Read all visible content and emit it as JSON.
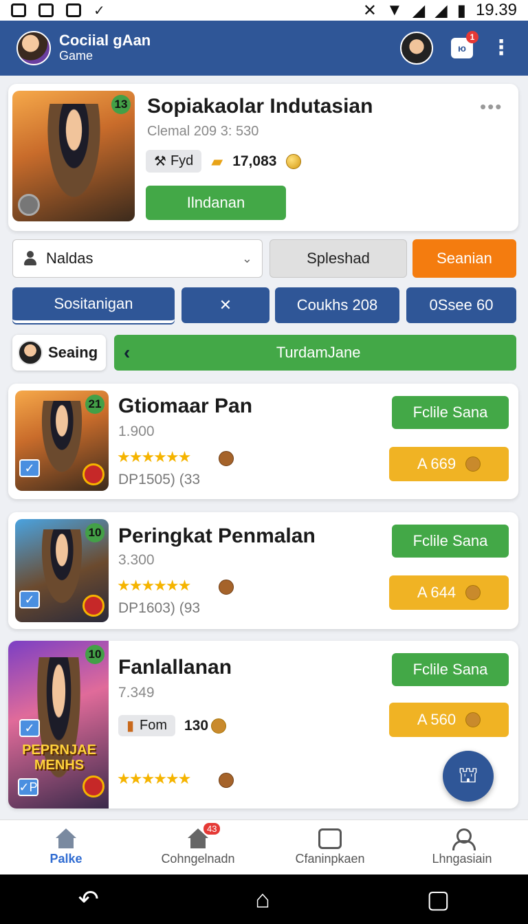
{
  "status": {
    "time": "19.39"
  },
  "appbar": {
    "title": "Cociial gAan",
    "subtitle": "Game",
    "notif_count": "1",
    "notif_label": "ю"
  },
  "hero": {
    "level": "13",
    "title": "Sopiakaolar Indutasian",
    "subtitle": "Clemal 209 3: 530",
    "tag": "Fyd",
    "coins": "17,083",
    "action": "Ilndanan"
  },
  "filters": {
    "select_value": "Naldas",
    "btn1": "Spleshad",
    "btn2": "Seanian"
  },
  "tabs": {
    "t1": "Sositanigan",
    "t2": "✕",
    "t3": "Coukhs 208",
    "t4": "0Ssee 60"
  },
  "seeing": {
    "label": "Seaing",
    "banner": "TurdamJane"
  },
  "games": [
    {
      "level": "21",
      "title": "Gtiomaar Pan",
      "sub": "1.900",
      "rating": "★★★★★★",
      "meta": "DP1505) (33",
      "follow": "Fclile Sana",
      "price": "A 669"
    },
    {
      "level": "10",
      "title": "Peringkat Penmalan",
      "sub": "3.300",
      "rating": "★★★★★★",
      "meta": "DP1603) (93",
      "follow": "Fclile Sana",
      "price": "A 644"
    },
    {
      "level": "10",
      "title": "Fanlallanan",
      "sub": "7.349",
      "pill": "Fom",
      "pill_value": "130",
      "rating": "★★★★★★",
      "overlay": "PEPRNJAE MENHS",
      "follow": "Fclile Sana",
      "price": "A 560"
    }
  ],
  "bottomnav": [
    {
      "label": "Palke"
    },
    {
      "label": "Cohngelnadn",
      "badge": "43"
    },
    {
      "label": "Cfaninpkaen"
    },
    {
      "label": "Lhngasiain"
    }
  ]
}
